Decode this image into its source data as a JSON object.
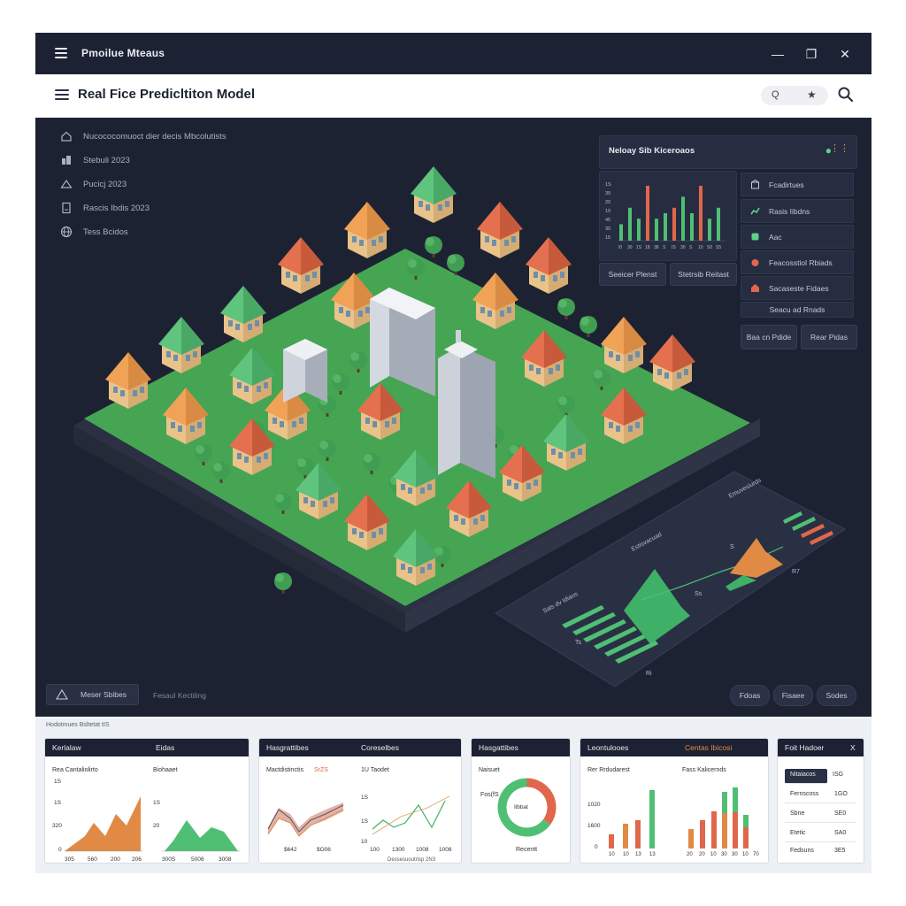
{
  "window": {
    "app_title": "Pmoilue Mteaus",
    "minimize": "—",
    "maximize": "❐",
    "close": "✕"
  },
  "toolbar": {
    "page_title": "Real Fice Predicltiton Model",
    "search_glyph1": "Q",
    "search_glyph2": "★"
  },
  "nav": [
    {
      "icon": "home-icon",
      "label": "Nucococomuoct dier decis Mbcolutists"
    },
    {
      "icon": "building-icon",
      "label": "Stebuli 2023"
    },
    {
      "icon": "house-icon",
      "label": "Pucicj 2023"
    },
    {
      "icon": "document-icon",
      "label": "Rascis Ibdis 2023"
    },
    {
      "icon": "globe-icon",
      "label": "Tess Bcidos"
    }
  ],
  "chart_panel": {
    "title": "Neloay Sib Kiceroaos",
    "icon": "search-icon",
    "menu": "⋮⋮"
  },
  "mini_bar_chart": {
    "type": "bar",
    "y_ticks": [
      "1S",
      "39",
      "20",
      "10",
      "45",
      "30",
      "15"
    ],
    "x_ticks": [
      "I0",
      "30",
      "1S",
      "18",
      "38",
      "S",
      "IS",
      "30",
      "S",
      "10",
      "S0",
      "S5"
    ],
    "values": [
      0.3,
      0.6,
      0.4,
      1.0,
      0.4,
      0.5,
      0.6,
      0.8,
      0.5,
      1.0,
      0.4,
      0.6
    ],
    "series_colors": [
      "#4fbf74",
      "#e0674c"
    ]
  },
  "chart_buttons": [
    "Seeicer Plenst",
    "Stetrsib Reitast"
  ],
  "right_list": [
    {
      "icon": "house-icon",
      "label": "Fcadirtues",
      "color": "#c5cad6"
    },
    {
      "icon": "chart-icon",
      "label": "Rasis Iibdns",
      "color": "#5fd18a"
    },
    {
      "icon": "tag-icon",
      "label": "Aac",
      "color": "#5fd18a"
    },
    {
      "icon": "fire-icon",
      "label": "Feacosstiol Rbiads",
      "color": "#e0674c"
    },
    {
      "icon": "home-icon",
      "label": "Sacaseste Fidaes",
      "color": "#e0674c"
    },
    {
      "icon": "list-icon",
      "label": "Seacu ad Rnads",
      "color": "#c5cad6"
    }
  ],
  "list_buttons": [
    "Baa cn Pdide",
    "Rear Pidas"
  ],
  "canvas_bottom": {
    "left_button": "Meser Sbibes",
    "left_text": "Fesaul Kectiling",
    "right_buttons": [
      "Fdoas",
      "Fisaee",
      "Sodes"
    ]
  },
  "floating_panel": {
    "labels": [
      "Sals dv Idiaos",
      "Estisvacuad",
      "Emuvesiurds",
      "Ss",
      "Ts",
      "Ri",
      "R7",
      "S"
    ]
  },
  "strip": {
    "label": "Hodotmues Bsltetat tIS",
    "cards": [
      {
        "title": "Kerlalaw",
        "title2": "Eidas",
        "sub1": "Rea Cantaliolirto",
        "sub2": "Biohaaet",
        "yl": [
          "1S",
          "1S",
          "320",
          "0"
        ],
        "yl2": [
          "1S",
          "20"
        ],
        "xl": [
          "305",
          "560",
          "200",
          "206"
        ],
        "xl2": [
          "300S",
          "5008",
          "3008"
        ]
      },
      {
        "title": "Hasgrattibes",
        "title2": "Coreselbes",
        "sub1": "Mactdistinctis",
        "sub1b": "SrZS",
        "sub2": "1U Taodet",
        "yl": [
          "1S",
          "1S",
          "10"
        ],
        "xl": [
          "$642",
          "$O06"
        ],
        "xl2": [
          "100",
          "1300",
          "1008",
          "1008"
        ],
        "foot": "Dessesuoutrisp 2N3"
      },
      {
        "title": "Hasgattibes",
        "sub1": "Naisuet",
        "center": "Ilbbat",
        "left": "Fos(fS",
        "foot": "Recentt",
        "donut": [
          0.35,
          0.65
        ]
      },
      {
        "title": "Leontulooes",
        "title2": "Centas Ibicosi",
        "sub1": "Rer Rrdudarest",
        "sub2": "Fass Kalicernds",
        "yl": [
          "1020",
          "1600",
          "0"
        ],
        "xl": [
          "0",
          "10",
          "10",
          "13",
          "13"
        ],
        "xl2": [
          "20",
          "20",
          "10",
          "30",
          "30",
          "10",
          "70"
        ]
      }
    ],
    "filter": {
      "title": "Foit Hadoer",
      "close": "X",
      "rows": [
        [
          "Nitaiacos",
          "ISG"
        ],
        [
          "Fernscoss",
          "1GO"
        ],
        [
          "Sbne",
          "SE0"
        ],
        [
          "Etetic",
          "SA0"
        ],
        [
          "Fedsuns",
          "3E5"
        ]
      ]
    }
  }
}
